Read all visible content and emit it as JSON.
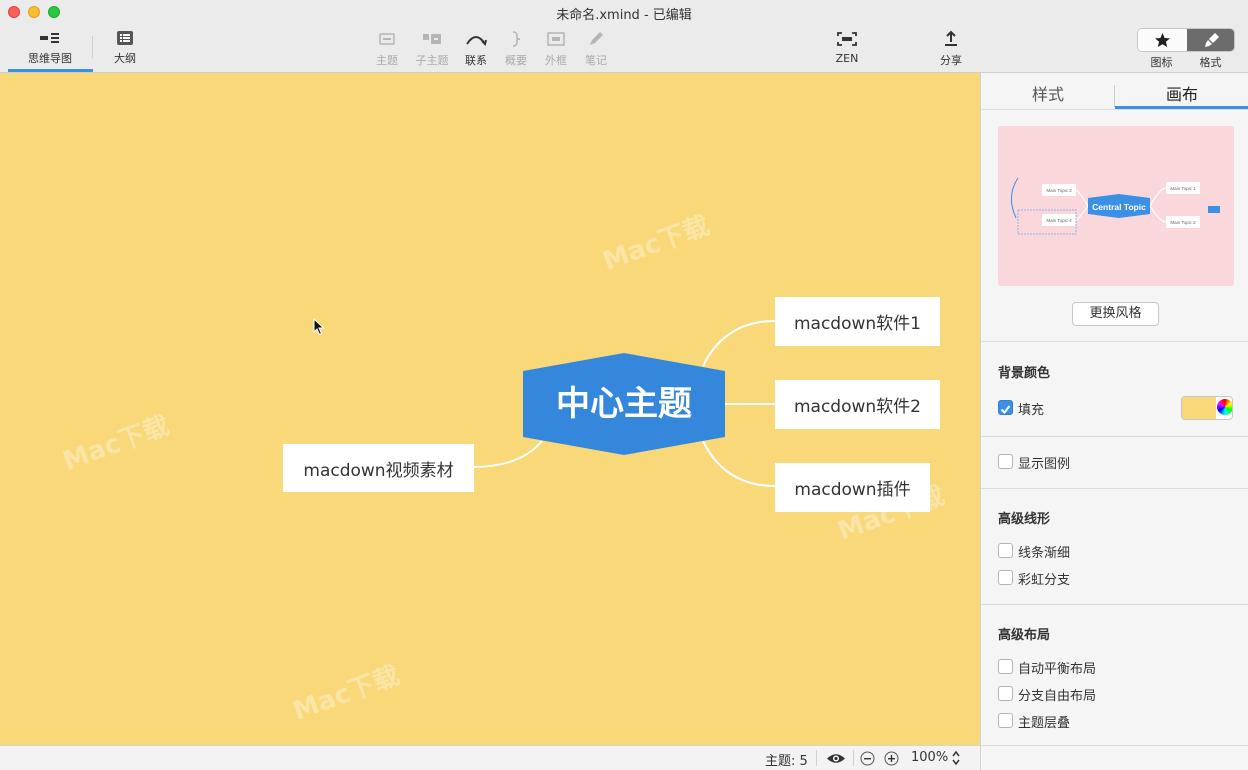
{
  "window": {
    "title": "未命名.xmind - 已编辑"
  },
  "toolbar": {
    "left_tabs": [
      {
        "label": "思维导图",
        "icon": "mindmap-icon"
      },
      {
        "label": "大纲",
        "icon": "outline-list-icon"
      }
    ],
    "center_tools": [
      {
        "label": "主题",
        "icon": "topic-icon",
        "enabled": false
      },
      {
        "label": "子主题",
        "icon": "subtopic-icon",
        "enabled": false
      },
      {
        "label": "联系",
        "icon": "relationship-icon",
        "enabled": true
      },
      {
        "label": "概要",
        "icon": "summary-brace-icon",
        "enabled": false
      },
      {
        "label": "外框",
        "icon": "boundary-icon",
        "enabled": false
      },
      {
        "label": "笔记",
        "icon": "note-pencil-icon",
        "enabled": false
      }
    ],
    "zen_label": "ZEN",
    "share_label": "分享",
    "icons_label": "图标",
    "format_label": "格式"
  },
  "canvas": {
    "background_color": "#f8d879",
    "central_topic": {
      "text": "中心主题",
      "color": "#3587dc"
    },
    "topics": [
      {
        "id": "t1",
        "text": "macdown软件1"
      },
      {
        "id": "t2",
        "text": "macdown软件2"
      },
      {
        "id": "t3",
        "text": "macdown插件"
      },
      {
        "id": "t4",
        "text": "macdown视频素材"
      }
    ]
  },
  "statusbar": {
    "topic_count": "主题: 5",
    "zoom": "100%"
  },
  "sidebar": {
    "tabs": [
      "样式",
      "画布"
    ],
    "active_tab": "画布",
    "preview_central": "Central Topic",
    "preview_topics": [
      "Main Topic 1",
      "Main Topic 2",
      "Main Topic 3",
      "Main Topic 4"
    ],
    "change_style_label": "更换风格",
    "background_section": "背景颜色",
    "fill_label": "填充",
    "fill_checked": true,
    "show_legend_label": "显示图例",
    "advanced_line_section": "高级线形",
    "taper_label": "线条渐细",
    "rainbow_label": "彩虹分支",
    "advanced_layout_section": "高级布局",
    "auto_balance_label": "自动平衡布局",
    "free_branch_label": "分支自由布局",
    "overlap_label": "主题层叠"
  }
}
